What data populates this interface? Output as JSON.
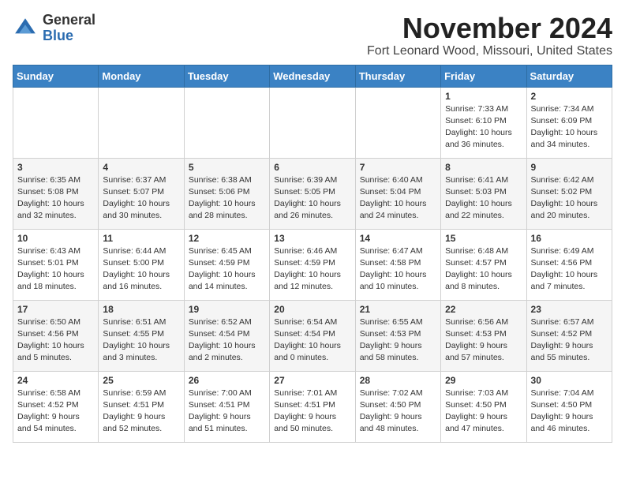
{
  "logo": {
    "general": "General",
    "blue": "Blue"
  },
  "header": {
    "month": "November 2024",
    "location": "Fort Leonard Wood, Missouri, United States"
  },
  "weekdays": [
    "Sunday",
    "Monday",
    "Tuesday",
    "Wednesday",
    "Thursday",
    "Friday",
    "Saturday"
  ],
  "weeks": [
    [
      {
        "day": "",
        "info": ""
      },
      {
        "day": "",
        "info": ""
      },
      {
        "day": "",
        "info": ""
      },
      {
        "day": "",
        "info": ""
      },
      {
        "day": "",
        "info": ""
      },
      {
        "day": "1",
        "info": "Sunrise: 7:33 AM\nSunset: 6:10 PM\nDaylight: 10 hours\nand 36 minutes."
      },
      {
        "day": "2",
        "info": "Sunrise: 7:34 AM\nSunset: 6:09 PM\nDaylight: 10 hours\nand 34 minutes."
      }
    ],
    [
      {
        "day": "3",
        "info": "Sunrise: 6:35 AM\nSunset: 5:08 PM\nDaylight: 10 hours\nand 32 minutes."
      },
      {
        "day": "4",
        "info": "Sunrise: 6:37 AM\nSunset: 5:07 PM\nDaylight: 10 hours\nand 30 minutes."
      },
      {
        "day": "5",
        "info": "Sunrise: 6:38 AM\nSunset: 5:06 PM\nDaylight: 10 hours\nand 28 minutes."
      },
      {
        "day": "6",
        "info": "Sunrise: 6:39 AM\nSunset: 5:05 PM\nDaylight: 10 hours\nand 26 minutes."
      },
      {
        "day": "7",
        "info": "Sunrise: 6:40 AM\nSunset: 5:04 PM\nDaylight: 10 hours\nand 24 minutes."
      },
      {
        "day": "8",
        "info": "Sunrise: 6:41 AM\nSunset: 5:03 PM\nDaylight: 10 hours\nand 22 minutes."
      },
      {
        "day": "9",
        "info": "Sunrise: 6:42 AM\nSunset: 5:02 PM\nDaylight: 10 hours\nand 20 minutes."
      }
    ],
    [
      {
        "day": "10",
        "info": "Sunrise: 6:43 AM\nSunset: 5:01 PM\nDaylight: 10 hours\nand 18 minutes."
      },
      {
        "day": "11",
        "info": "Sunrise: 6:44 AM\nSunset: 5:00 PM\nDaylight: 10 hours\nand 16 minutes."
      },
      {
        "day": "12",
        "info": "Sunrise: 6:45 AM\nSunset: 4:59 PM\nDaylight: 10 hours\nand 14 minutes."
      },
      {
        "day": "13",
        "info": "Sunrise: 6:46 AM\nSunset: 4:59 PM\nDaylight: 10 hours\nand 12 minutes."
      },
      {
        "day": "14",
        "info": "Sunrise: 6:47 AM\nSunset: 4:58 PM\nDaylight: 10 hours\nand 10 minutes."
      },
      {
        "day": "15",
        "info": "Sunrise: 6:48 AM\nSunset: 4:57 PM\nDaylight: 10 hours\nand 8 minutes."
      },
      {
        "day": "16",
        "info": "Sunrise: 6:49 AM\nSunset: 4:56 PM\nDaylight: 10 hours\nand 7 minutes."
      }
    ],
    [
      {
        "day": "17",
        "info": "Sunrise: 6:50 AM\nSunset: 4:56 PM\nDaylight: 10 hours\nand 5 minutes."
      },
      {
        "day": "18",
        "info": "Sunrise: 6:51 AM\nSunset: 4:55 PM\nDaylight: 10 hours\nand 3 minutes."
      },
      {
        "day": "19",
        "info": "Sunrise: 6:52 AM\nSunset: 4:54 PM\nDaylight: 10 hours\nand 2 minutes."
      },
      {
        "day": "20",
        "info": "Sunrise: 6:54 AM\nSunset: 4:54 PM\nDaylight: 10 hours\nand 0 minutes."
      },
      {
        "day": "21",
        "info": "Sunrise: 6:55 AM\nSunset: 4:53 PM\nDaylight: 9 hours\nand 58 minutes."
      },
      {
        "day": "22",
        "info": "Sunrise: 6:56 AM\nSunset: 4:53 PM\nDaylight: 9 hours\nand 57 minutes."
      },
      {
        "day": "23",
        "info": "Sunrise: 6:57 AM\nSunset: 4:52 PM\nDaylight: 9 hours\nand 55 minutes."
      }
    ],
    [
      {
        "day": "24",
        "info": "Sunrise: 6:58 AM\nSunset: 4:52 PM\nDaylight: 9 hours\nand 54 minutes."
      },
      {
        "day": "25",
        "info": "Sunrise: 6:59 AM\nSunset: 4:51 PM\nDaylight: 9 hours\nand 52 minutes."
      },
      {
        "day": "26",
        "info": "Sunrise: 7:00 AM\nSunset: 4:51 PM\nDaylight: 9 hours\nand 51 minutes."
      },
      {
        "day": "27",
        "info": "Sunrise: 7:01 AM\nSunset: 4:51 PM\nDaylight: 9 hours\nand 50 minutes."
      },
      {
        "day": "28",
        "info": "Sunrise: 7:02 AM\nSunset: 4:50 PM\nDaylight: 9 hours\nand 48 minutes."
      },
      {
        "day": "29",
        "info": "Sunrise: 7:03 AM\nSunset: 4:50 PM\nDaylight: 9 hours\nand 47 minutes."
      },
      {
        "day": "30",
        "info": "Sunrise: 7:04 AM\nSunset: 4:50 PM\nDaylight: 9 hours\nand 46 minutes."
      }
    ]
  ]
}
